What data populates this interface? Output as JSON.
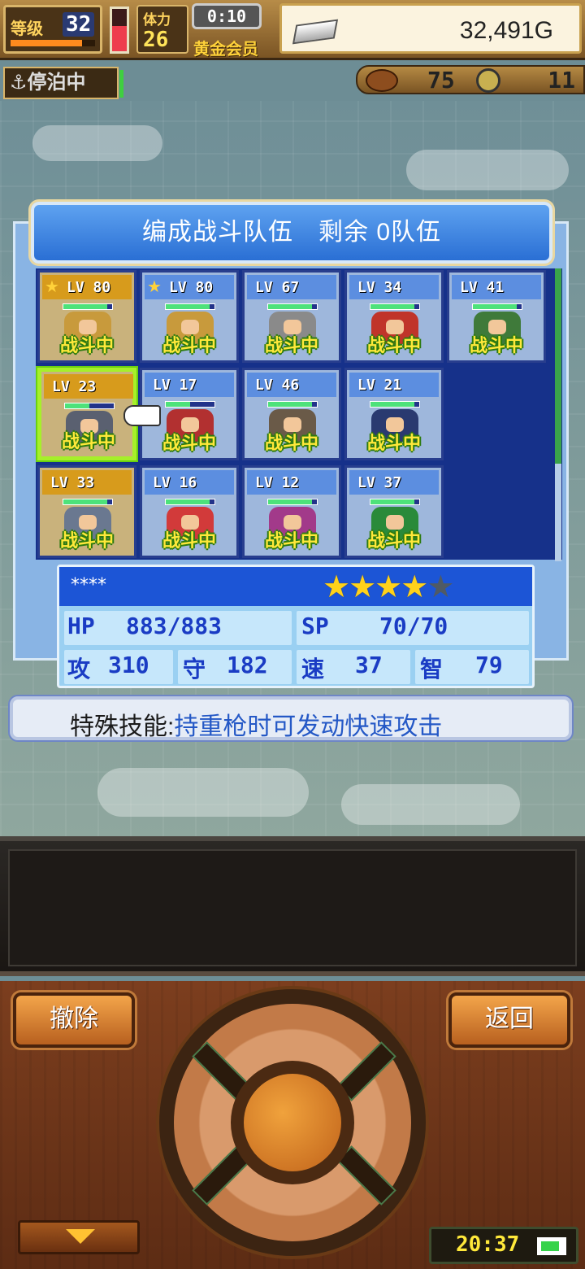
{
  "hud": {
    "level_label": "等级",
    "level_value": "32",
    "xp_fraction": 0.85,
    "stamina_label": "体力",
    "stamina_value": "26",
    "gauge_fraction": 0.6,
    "timer": "0:10",
    "member": "黄金会员",
    "gold": "32,491G",
    "status": "⚓停泊中",
    "res1": "75",
    "res2": "11"
  },
  "panel": {
    "title": "编成战斗队伍　剩余 0队伍",
    "tag": "战斗中"
  },
  "party": [
    {
      "lv": "LV 80",
      "star": true,
      "style": "gold",
      "hp": 0.9,
      "sprite": "#c89a3c"
    },
    {
      "lv": "LV 80",
      "star": true,
      "style": "blue",
      "hp": 0.9,
      "sprite": "#c89a3c"
    },
    {
      "lv": "LV 67",
      "star": false,
      "style": "blue",
      "hp": 0.9,
      "sprite": "#8a8a8a"
    },
    {
      "lv": "LV 34",
      "star": false,
      "style": "blue",
      "hp": 0.9,
      "sprite": "#c0342a"
    },
    {
      "lv": "LV 41",
      "star": false,
      "style": "blue",
      "hp": 0.9,
      "sprite": "#3f7a3a"
    },
    {
      "lv": "LV 23",
      "star": false,
      "style": "gold",
      "hp": 0.5,
      "sprite": "#5a6070"
    },
    {
      "lv": "LV 17",
      "star": false,
      "style": "blue",
      "hp": 0.5,
      "sprite": "#b23030"
    },
    {
      "lv": "LV 46",
      "star": false,
      "style": "blue",
      "hp": 0.9,
      "sprite": "#6a5a48"
    },
    {
      "lv": "LV 21",
      "star": false,
      "style": "blue",
      "hp": 0.9,
      "sprite": "#2a3a70"
    },
    {
      "lv": "LV 33",
      "star": false,
      "style": "gold",
      "hp": 0.9,
      "sprite": "#6a7890"
    },
    {
      "lv": "LV 16",
      "star": false,
      "style": "blue",
      "hp": 0.9,
      "sprite": "#d23a3a"
    },
    {
      "lv": "LV 12",
      "star": false,
      "style": "blue",
      "hp": 0.9,
      "sprite": "#a23a8a"
    },
    {
      "lv": "LV 37",
      "star": false,
      "style": "blue",
      "hp": 0.9,
      "sprite": "#2a8a3a"
    }
  ],
  "selected": {
    "name": "****",
    "stars": 4,
    "stars_max": 5,
    "hp_label": "HP",
    "hp_value": "883/883",
    "sp_label": "SP",
    "sp_value": "70/70",
    "atk_label": "攻",
    "atk_value": "310",
    "def_label": "守",
    "def_value": "182",
    "spd_label": "速",
    "spd_value": "37",
    "int_label": "智",
    "int_value": "79"
  },
  "skill": {
    "label": "特殊技能:",
    "value": "持重枪时可发动快速攻击"
  },
  "controls": {
    "remove": "撤除",
    "back": "返回"
  },
  "clock": "20:37",
  "colors": {
    "accent": "#2a6fd4",
    "tag": "#ffe83a",
    "select": "#a6f02a"
  }
}
